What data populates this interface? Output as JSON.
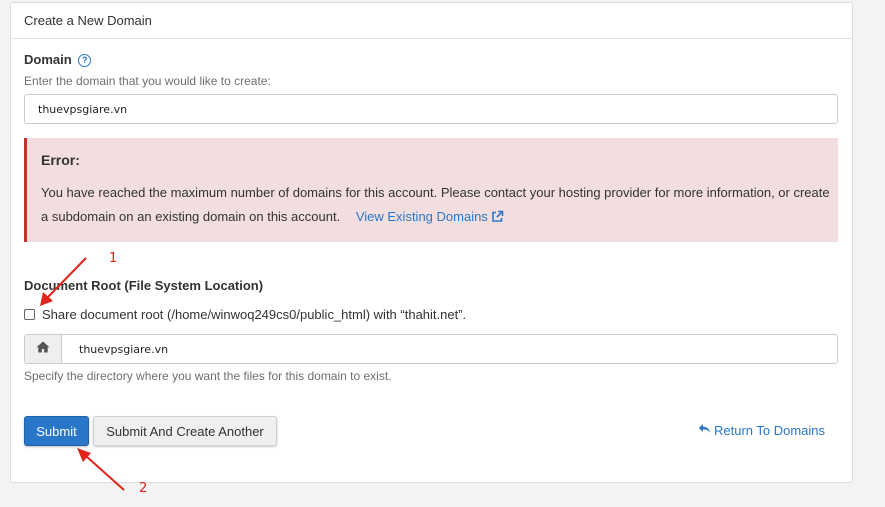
{
  "panel": {
    "title": "Create a New Domain"
  },
  "domain": {
    "label": "Domain",
    "help_glyph": "?",
    "hint": "Enter the domain that you would like to create:",
    "value": "thuevpsgiare.vn"
  },
  "error": {
    "title": "Error:",
    "message": "You have reached the maximum number of domains for this account. Please contact your hosting provider for more information, or create a subdomain on an existing domain on this account.",
    "link_label": "View Existing Domains"
  },
  "docroot": {
    "label": "Document Root (File System Location)",
    "share_label": "Share document root (/home/winwoq249cs0/public_html) with “thahit.net”.",
    "share_checked": false,
    "home_icon": "home-icon",
    "value": "thuevpsgiare.vn",
    "hint": "Specify the directory where you want the files for this domain to exist."
  },
  "actions": {
    "submit_label": "Submit",
    "submit_another_label": "Submit And Create Another",
    "return_label": "Return To Domains",
    "return_icon": "reply-icon"
  },
  "annotations": {
    "marker_1": "1",
    "marker_2": "2",
    "color": "#e0241b"
  },
  "colors": {
    "accent": "#2a77c9",
    "error_bg": "#f2dede",
    "error_border": "#c9302c"
  }
}
